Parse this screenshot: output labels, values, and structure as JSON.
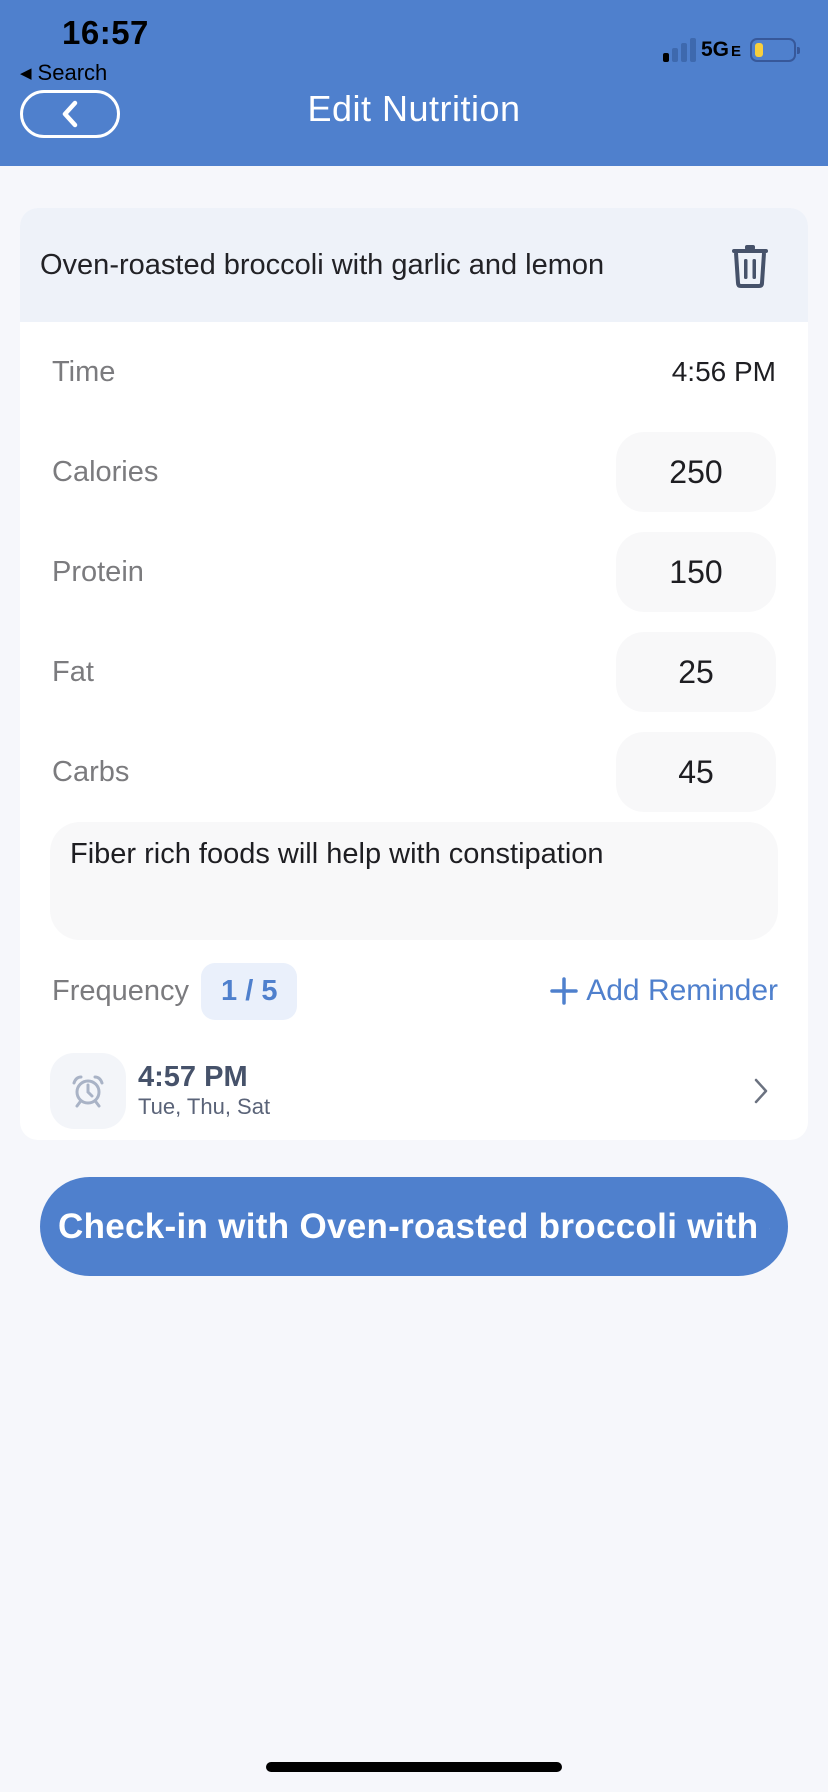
{
  "status_bar": {
    "time": "16:57",
    "back_app": "Search",
    "network": "5G",
    "network_suffix": "E",
    "signal_bars_active": 1,
    "signal_bars_total": 4,
    "battery_level_fraction": 0.15,
    "battery_color": "#F7CF3D"
  },
  "header": {
    "title": "Edit Nutrition",
    "back_icon": "chevron-left-icon",
    "background": "#4F80CD"
  },
  "food": {
    "name": "Oven-roasted broccoli with garlic and lemon",
    "delete_icon": "trash-icon"
  },
  "fields": [
    {
      "label": "Time",
      "value": "4:56 PM"
    },
    {
      "label": "Calories",
      "value": "250"
    },
    {
      "label": "Protein",
      "value": "150"
    },
    {
      "label": "Fat",
      "value": "25"
    },
    {
      "label": "Carbs",
      "value": "45"
    }
  ],
  "notes": "Fiber rich foods will help with constipation",
  "frequency": {
    "label": "Frequency",
    "value": "1 / 5"
  },
  "add_reminder": {
    "label": "Add Reminder",
    "icon": "plus-icon"
  },
  "reminders": [
    {
      "time": "4:57 PM",
      "days": "Tue, Thu, Sat",
      "icon": "alarm-clock-icon"
    }
  ],
  "checkin_button": {
    "label": "Check-in with Oven-roasted broccoli with garlic and lemon"
  },
  "colors": {
    "accent": "#4F80CD",
    "page_bg": "#F6F7FB",
    "card_header_bg": "#EEF2F9"
  }
}
